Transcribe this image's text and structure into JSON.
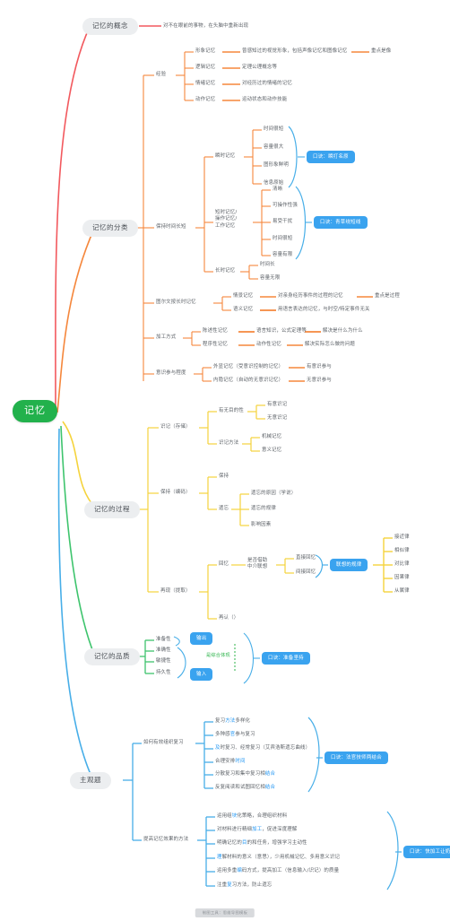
{
  "root": {
    "label": "记忆",
    "color": "#22b14c"
  },
  "colors": {
    "branch_concept": "#f2595e",
    "branch_classify": "#f5873c",
    "branch_process": "#f5d33c",
    "branch_quality": "#3ec46d",
    "branch_subjective": "#47aee8",
    "badge": "#3aa3ef",
    "root": "#22b14c",
    "pill_bg": "#eceef0"
  },
  "branches": [
    {
      "id": "concept",
      "label": "记忆的概念",
      "leaves": [
        {
          "text": "对不在眼前的事物，在头脑中重新出现"
        }
      ]
    },
    {
      "id": "classify",
      "label": "记忆的分类",
      "groups": [
        {
          "label": "经验",
          "items": [
            {
              "text": "形象记忆",
              "detail": "曾感知过的视觉形象，包括声像记忆和图像记忆",
              "detail2": "重点是像"
            },
            {
              "text": "逻辑记忆",
              "detail": "定理公理概念等"
            },
            {
              "text": "情绪记忆",
              "detail": "对经历过的情绪的记忆"
            },
            {
              "text": "动作记忆",
              "detail": "运动状态和动作技能"
            }
          ]
        },
        {
          "label": "保持时间长短",
          "subgroups": [
            {
              "label": "瞬时记忆",
              "items": [
                "时间很短",
                "容量很大",
                "图形象鲜明",
                "信息原始"
              ],
              "badge": "口诀：瞬打名原"
            },
            {
              "label": "短时记忆/\n操作记忆/\n工作记忆",
              "items": [
                "清晰",
                "可操作性强",
                "易受干扰",
                "时间很短",
                "容量有限"
              ],
              "badge": "口诀：青草绕短线"
            },
            {
              "label": "长时记忆",
              "items": [
                "时间长",
                "容量无限"
              ]
            }
          ]
        },
        {
          "label": "图尔文按长时记忆",
          "items": [
            {
              "text": "情景记忆",
              "detail": "对亲身经历事件的过程的记忆",
              "detail2": "重点是过程"
            },
            {
              "text": "语义记忆",
              "detail": "用语言表达的记忆，与时空/特定事件无关"
            }
          ]
        },
        {
          "label": "加工方式",
          "items": [
            {
              "text": "陈述性记忆",
              "detail": "语言知识，公式定理等",
              "detail2": "解决是什么为什么"
            },
            {
              "text": "程序性记忆",
              "detail": "动作性记忆",
              "detail2": "解决实际怎么做的问题"
            }
          ]
        },
        {
          "label": "意识参与程度",
          "items": [
            {
              "text": "外显记忆（受意识控制的记忆）",
              "detail": "有意识参与"
            },
            {
              "text": "内隐记忆（自动的无意识记忆）",
              "detail": "无意识参与"
            }
          ]
        }
      ]
    },
    {
      "id": "process",
      "label": "记忆的过程",
      "groups": [
        {
          "label": "识记（存储）",
          "subgroups": [
            {
              "label": "有无目的性",
              "items": [
                "有意识记",
                "无意识记"
              ]
            },
            {
              "label": "识记方法",
              "items": [
                "机械记忆",
                "意义记忆"
              ]
            }
          ]
        },
        {
          "label": "保持（编码）",
          "subgroups": [
            {
              "label": "保持",
              "items": []
            },
            {
              "label": "遗忘",
              "items": [
                "遗忘的原因（学说）",
                "遗忘的规律",
                "影响因素"
              ]
            }
          ]
        },
        {
          "label": "再现（提取）",
          "recall": {
            "label": "回忆",
            "criterion": "是否借助\n中介联想",
            "items": [
              "直接回忆",
              "间接回忆"
            ],
            "badge": "联想的规律",
            "laws": [
              "接近律",
              "相似律",
              "对比律",
              "因果律",
              "从属律"
            ]
          },
          "recognize": "再认（）"
        }
      ]
    },
    {
      "id": "quality",
      "label": "记忆的品质",
      "items": [
        "准备性",
        "准确性",
        "敏捷性",
        "持久性"
      ],
      "boxes": [
        "输出",
        "输入"
      ],
      "note": "是综合体现",
      "badge": "口诀：准备坚持"
    },
    {
      "id": "subjective",
      "label": "主观题",
      "groups": [
        {
          "label": "如何有效组织复习",
          "items": [
            {
              "pre": "复习",
              "hl": "方法",
              "post": "多样化"
            },
            {
              "pre": "多种感",
              "hl": "官",
              "post": "参与复习"
            },
            {
              "pre": "",
              "hl": "及",
              "post": "时复习、经常复习（艾宾浩斯遗忘曲线）"
            },
            {
              "pre": "合理安排",
              "hl": "时间",
              "post": ""
            },
            {
              "pre": "分散复习和集中复习相",
              "hl": "结合",
              "post": ""
            },
            {
              "pre": "反复阅读和试图回忆相",
              "hl": "结合",
              "post": ""
            }
          ],
          "badge": "口诀：法官技师两结合"
        },
        {
          "label": "提高记忆效果的方法",
          "items": [
            {
              "pre": "运用组",
              "hl": "块",
              "post": "化策略，合理组织材料"
            },
            {
              "pre": "对材料进行精细",
              "hl": "加工",
              "post": "，促进深度理解"
            },
            {
              "pre": "明确记忆的",
              "hl": "目",
              "post": "的和任务，增强学习主动性"
            },
            {
              "pre": "",
              "hl": "理",
              "post": "解材料的意义（意思），少用机械记忆、多用意义识记"
            },
            {
              "pre": "运用多重",
              "hl": "编",
              "post": "码方式，提高加工（信息输入/识记）的质量"
            },
            {
              "pre": "注重",
              "hl": "复",
              "post": "习方法，防止遗忘"
            }
          ],
          "badge": "口诀：快加工让奶和编辑"
        }
      ]
    }
  ],
  "watermark": "制图工具：思维导图模板"
}
